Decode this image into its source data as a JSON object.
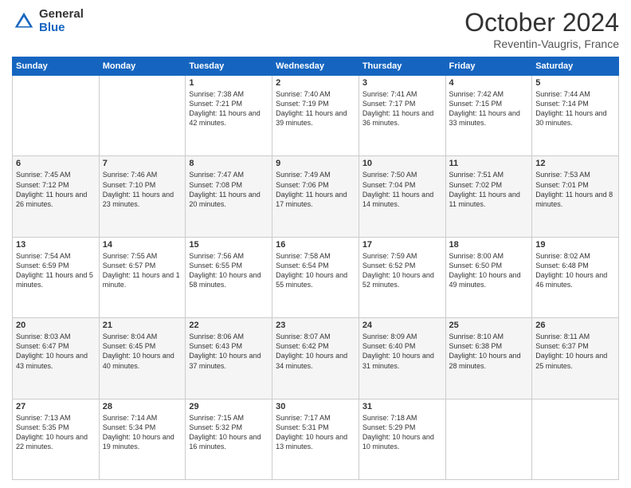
{
  "header": {
    "logo_general": "General",
    "logo_blue": "Blue",
    "title": "October 2024",
    "subtitle": "Reventin-Vaugris, France"
  },
  "columns": [
    "Sunday",
    "Monday",
    "Tuesday",
    "Wednesday",
    "Thursday",
    "Friday",
    "Saturday"
  ],
  "weeks": [
    [
      {
        "day": "",
        "sunrise": "",
        "sunset": "",
        "daylight": ""
      },
      {
        "day": "",
        "sunrise": "",
        "sunset": "",
        "daylight": ""
      },
      {
        "day": "1",
        "sunrise": "Sunrise: 7:38 AM",
        "sunset": "Sunset: 7:21 PM",
        "daylight": "Daylight: 11 hours and 42 minutes."
      },
      {
        "day": "2",
        "sunrise": "Sunrise: 7:40 AM",
        "sunset": "Sunset: 7:19 PM",
        "daylight": "Daylight: 11 hours and 39 minutes."
      },
      {
        "day": "3",
        "sunrise": "Sunrise: 7:41 AM",
        "sunset": "Sunset: 7:17 PM",
        "daylight": "Daylight: 11 hours and 36 minutes."
      },
      {
        "day": "4",
        "sunrise": "Sunrise: 7:42 AM",
        "sunset": "Sunset: 7:15 PM",
        "daylight": "Daylight: 11 hours and 33 minutes."
      },
      {
        "day": "5",
        "sunrise": "Sunrise: 7:44 AM",
        "sunset": "Sunset: 7:14 PM",
        "daylight": "Daylight: 11 hours and 30 minutes."
      }
    ],
    [
      {
        "day": "6",
        "sunrise": "Sunrise: 7:45 AM",
        "sunset": "Sunset: 7:12 PM",
        "daylight": "Daylight: 11 hours and 26 minutes."
      },
      {
        "day": "7",
        "sunrise": "Sunrise: 7:46 AM",
        "sunset": "Sunset: 7:10 PM",
        "daylight": "Daylight: 11 hours and 23 minutes."
      },
      {
        "day": "8",
        "sunrise": "Sunrise: 7:47 AM",
        "sunset": "Sunset: 7:08 PM",
        "daylight": "Daylight: 11 hours and 20 minutes."
      },
      {
        "day": "9",
        "sunrise": "Sunrise: 7:49 AM",
        "sunset": "Sunset: 7:06 PM",
        "daylight": "Daylight: 11 hours and 17 minutes."
      },
      {
        "day": "10",
        "sunrise": "Sunrise: 7:50 AM",
        "sunset": "Sunset: 7:04 PM",
        "daylight": "Daylight: 11 hours and 14 minutes."
      },
      {
        "day": "11",
        "sunrise": "Sunrise: 7:51 AM",
        "sunset": "Sunset: 7:02 PM",
        "daylight": "Daylight: 11 hours and 11 minutes."
      },
      {
        "day": "12",
        "sunrise": "Sunrise: 7:53 AM",
        "sunset": "Sunset: 7:01 PM",
        "daylight": "Daylight: 11 hours and 8 minutes."
      }
    ],
    [
      {
        "day": "13",
        "sunrise": "Sunrise: 7:54 AM",
        "sunset": "Sunset: 6:59 PM",
        "daylight": "Daylight: 11 hours and 5 minutes."
      },
      {
        "day": "14",
        "sunrise": "Sunrise: 7:55 AM",
        "sunset": "Sunset: 6:57 PM",
        "daylight": "Daylight: 11 hours and 1 minute."
      },
      {
        "day": "15",
        "sunrise": "Sunrise: 7:56 AM",
        "sunset": "Sunset: 6:55 PM",
        "daylight": "Daylight: 10 hours and 58 minutes."
      },
      {
        "day": "16",
        "sunrise": "Sunrise: 7:58 AM",
        "sunset": "Sunset: 6:54 PM",
        "daylight": "Daylight: 10 hours and 55 minutes."
      },
      {
        "day": "17",
        "sunrise": "Sunrise: 7:59 AM",
        "sunset": "Sunset: 6:52 PM",
        "daylight": "Daylight: 10 hours and 52 minutes."
      },
      {
        "day": "18",
        "sunrise": "Sunrise: 8:00 AM",
        "sunset": "Sunset: 6:50 PM",
        "daylight": "Daylight: 10 hours and 49 minutes."
      },
      {
        "day": "19",
        "sunrise": "Sunrise: 8:02 AM",
        "sunset": "Sunset: 6:48 PM",
        "daylight": "Daylight: 10 hours and 46 minutes."
      }
    ],
    [
      {
        "day": "20",
        "sunrise": "Sunrise: 8:03 AM",
        "sunset": "Sunset: 6:47 PM",
        "daylight": "Daylight: 10 hours and 43 minutes."
      },
      {
        "day": "21",
        "sunrise": "Sunrise: 8:04 AM",
        "sunset": "Sunset: 6:45 PM",
        "daylight": "Daylight: 10 hours and 40 minutes."
      },
      {
        "day": "22",
        "sunrise": "Sunrise: 8:06 AM",
        "sunset": "Sunset: 6:43 PM",
        "daylight": "Daylight: 10 hours and 37 minutes."
      },
      {
        "day": "23",
        "sunrise": "Sunrise: 8:07 AM",
        "sunset": "Sunset: 6:42 PM",
        "daylight": "Daylight: 10 hours and 34 minutes."
      },
      {
        "day": "24",
        "sunrise": "Sunrise: 8:09 AM",
        "sunset": "Sunset: 6:40 PM",
        "daylight": "Daylight: 10 hours and 31 minutes."
      },
      {
        "day": "25",
        "sunrise": "Sunrise: 8:10 AM",
        "sunset": "Sunset: 6:38 PM",
        "daylight": "Daylight: 10 hours and 28 minutes."
      },
      {
        "day": "26",
        "sunrise": "Sunrise: 8:11 AM",
        "sunset": "Sunset: 6:37 PM",
        "daylight": "Daylight: 10 hours and 25 minutes."
      }
    ],
    [
      {
        "day": "27",
        "sunrise": "Sunrise: 7:13 AM",
        "sunset": "Sunset: 5:35 PM",
        "daylight": "Daylight: 10 hours and 22 minutes."
      },
      {
        "day": "28",
        "sunrise": "Sunrise: 7:14 AM",
        "sunset": "Sunset: 5:34 PM",
        "daylight": "Daylight: 10 hours and 19 minutes."
      },
      {
        "day": "29",
        "sunrise": "Sunrise: 7:15 AM",
        "sunset": "Sunset: 5:32 PM",
        "daylight": "Daylight: 10 hours and 16 minutes."
      },
      {
        "day": "30",
        "sunrise": "Sunrise: 7:17 AM",
        "sunset": "Sunset: 5:31 PM",
        "daylight": "Daylight: 10 hours and 13 minutes."
      },
      {
        "day": "31",
        "sunrise": "Sunrise: 7:18 AM",
        "sunset": "Sunset: 5:29 PM",
        "daylight": "Daylight: 10 hours and 10 minutes."
      },
      {
        "day": "",
        "sunrise": "",
        "sunset": "",
        "daylight": ""
      },
      {
        "day": "",
        "sunrise": "",
        "sunset": "",
        "daylight": ""
      }
    ]
  ]
}
